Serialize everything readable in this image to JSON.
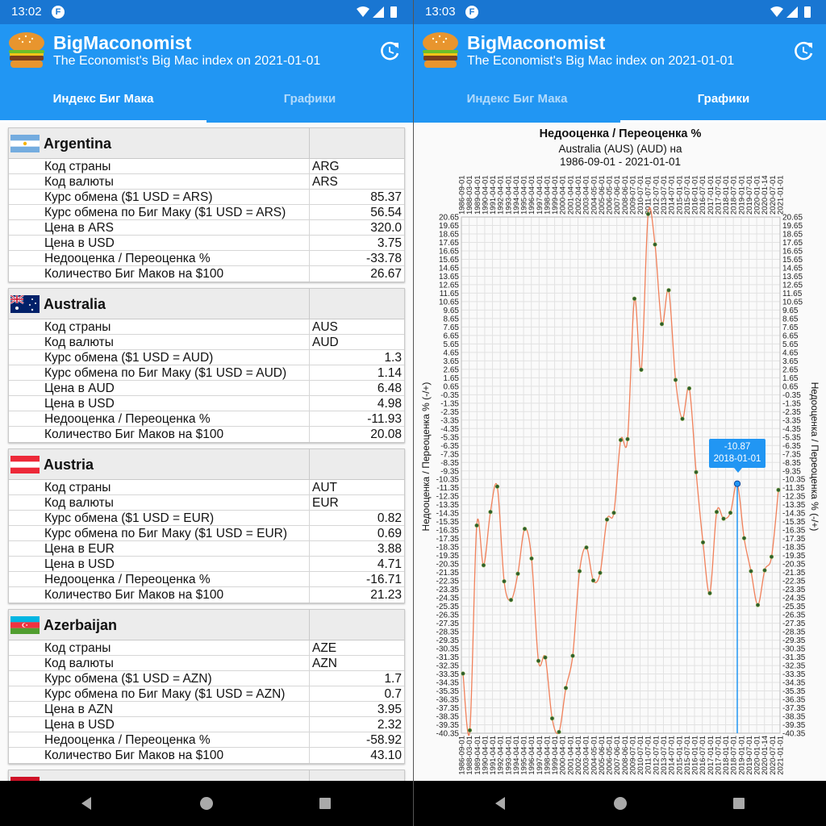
{
  "left_screen": {
    "status": {
      "time": "13:02",
      "badge": "F"
    },
    "app": {
      "title": "BigMaconomist",
      "subtitle": "The Economist's Big Mac index on 2021-01-01"
    },
    "tabs": [
      {
        "label": "Индекс Биг Мака",
        "active": true
      },
      {
        "label": "Графики",
        "active": false
      }
    ],
    "countries": [
      {
        "name": "Argentina",
        "flag": "argentina-flag",
        "rows": [
          {
            "label": "Код страны",
            "value": "ARG",
            "align": "left"
          },
          {
            "label": "Код валюты",
            "value": "ARS",
            "align": "left"
          },
          {
            "label": "Курс обмена ($1 USD = ARS)",
            "value": "85.37",
            "align": "right"
          },
          {
            "label": "Курс обмена по Биг Маку ($1 USD = ARS)",
            "value": "56.54",
            "align": "right"
          },
          {
            "label": "Цена в ARS",
            "value": "320.0",
            "align": "right"
          },
          {
            "label": "Цена в USD",
            "value": "3.75",
            "align": "right"
          },
          {
            "label": "Недооценка / Переоценка %",
            "value": "-33.78",
            "align": "right"
          },
          {
            "label": "Количество Биг Маков на $100",
            "value": "26.67",
            "align": "right"
          }
        ]
      },
      {
        "name": "Australia",
        "flag": "australia-flag",
        "rows": [
          {
            "label": "Код страны",
            "value": "AUS",
            "align": "left"
          },
          {
            "label": "Код валюты",
            "value": "AUD",
            "align": "left"
          },
          {
            "label": "Курс обмена ($1 USD = AUD)",
            "value": "1.3",
            "align": "right"
          },
          {
            "label": "Курс обмена по Биг Маку ($1 USD = AUD)",
            "value": "1.14",
            "align": "right"
          },
          {
            "label": "Цена в AUD",
            "value": "6.48",
            "align": "right"
          },
          {
            "label": "Цена в USD",
            "value": "4.98",
            "align": "right"
          },
          {
            "label": "Недооценка / Переоценка %",
            "value": "-11.93",
            "align": "right"
          },
          {
            "label": "Количество Биг Маков на $100",
            "value": "20.08",
            "align": "right"
          }
        ]
      },
      {
        "name": "Austria",
        "flag": "austria-flag",
        "rows": [
          {
            "label": "Код страны",
            "value": "AUT",
            "align": "left"
          },
          {
            "label": "Код валюты",
            "value": "EUR",
            "align": "left"
          },
          {
            "label": "Курс обмена ($1 USD = EUR)",
            "value": "0.82",
            "align": "right"
          },
          {
            "label": "Курс обмена по Биг Маку ($1 USD = EUR)",
            "value": "0.69",
            "align": "right"
          },
          {
            "label": "Цена в EUR",
            "value": "3.88",
            "align": "right"
          },
          {
            "label": "Цена в USD",
            "value": "4.71",
            "align": "right"
          },
          {
            "label": "Недооценка / Переоценка %",
            "value": "-16.71",
            "align": "right"
          },
          {
            "label": "Количество Биг Маков на $100",
            "value": "21.23",
            "align": "right"
          }
        ]
      },
      {
        "name": "Azerbaijan",
        "flag": "azerbaijan-flag",
        "rows": [
          {
            "label": "Код страны",
            "value": "AZE",
            "align": "left"
          },
          {
            "label": "Код валюты",
            "value": "AZN",
            "align": "left"
          },
          {
            "label": "Курс обмена ($1 USD = AZN)",
            "value": "1.7",
            "align": "right"
          },
          {
            "label": "Курс обмена по Биг Маку ($1 USD = AZN)",
            "value": "0.7",
            "align": "right"
          },
          {
            "label": "Цена в AZN",
            "value": "3.95",
            "align": "right"
          },
          {
            "label": "Цена в USD",
            "value": "2.32",
            "align": "right"
          },
          {
            "label": "Недооценка / Переоценка %",
            "value": "-58.92",
            "align": "right"
          },
          {
            "label": "Количество Биг Маков на $100",
            "value": "43.10",
            "align": "right"
          }
        ]
      }
    ]
  },
  "right_screen": {
    "status": {
      "time": "13:03",
      "badge": "F"
    },
    "app": {
      "title": "BigMaconomist",
      "subtitle": "The Economist's Big Mac index on 2021-01-01"
    },
    "tabs": [
      {
        "label": "Индекс Биг Мака",
        "active": false
      },
      {
        "label": "Графики",
        "active": true
      }
    ],
    "chart_header": {
      "title": "Недооценка / Переоценка %",
      "subtitle_line1": "Australia (AUS) (AUD) на",
      "subtitle_line2": "1986-09-01 - 2021-01-01",
      "y_axis_label": "Недооценка / Переоценка % (-/+)"
    },
    "tooltip": {
      "value": "-10.87",
      "date": "2018-01-01"
    }
  },
  "chart_data": {
    "type": "line",
    "title": "Недооценка / Переоценка %",
    "subtitle": "Australia (AUS) (AUD) на 1986-09-01 - 2021-01-01",
    "ylabel": "Недооценка / Переоценка % (-/+)",
    "ylim": [
      -40.35,
      20.65
    ],
    "y_ticks": [
      20.65,
      19.65,
      18.65,
      17.65,
      16.65,
      15.65,
      14.65,
      13.65,
      12.65,
      11.65,
      10.65,
      9.65,
      8.65,
      7.65,
      6.65,
      5.65,
      4.65,
      3.65,
      2.65,
      1.65,
      0.65,
      -0.35,
      -1.35,
      -2.35,
      -3.35,
      -4.35,
      -5.35,
      -6.35,
      -7.35,
      -8.35,
      -9.35,
      -10.35,
      -11.35,
      -12.35,
      -13.35,
      -14.35,
      -15.35,
      -16.35,
      -17.35,
      -18.35,
      -19.35,
      -20.35,
      -21.35,
      -22.35,
      -23.35,
      -24.35,
      -25.35,
      -26.35,
      -27.35,
      -28.35,
      -29.35,
      -30.35,
      -31.35,
      -32.35,
      -33.35,
      -34.35,
      -35.35,
      -36.35,
      -37.35,
      -38.35,
      -39.35,
      -40.35
    ],
    "x_ticks": [
      "1986-09-01",
      "1988-03-01",
      "1989-04-01",
      "1990-04-01",
      "1991-04-01",
      "1992-04-01",
      "1993-04-01",
      "1994-04-01",
      "1995-04-01",
      "1996-04-01",
      "1997-04-01",
      "1998-04-01",
      "1999-04-01",
      "2000-04-01",
      "2001-04-01",
      "2002-04-01",
      "2003-04-01",
      "2004-05-01",
      "2005-06-01",
      "2006-05-01",
      "2007-06-01",
      "2008-06-01",
      "2009-07-01",
      "2010-07-01",
      "2011-07-01",
      "2012-07-01",
      "2013-07-01",
      "2014-07-01",
      "2015-01-01",
      "2015-07-01",
      "2016-01-01",
      "2016-07-01",
      "2017-01-01",
      "2017-07-01",
      "2018-01-01",
      "2018-07-01",
      "2019-01-01",
      "2019-07-01",
      "2020-01-01",
      "2020-01-14",
      "2020-07-01",
      "2021-01-01"
    ],
    "series": [
      {
        "name": "Australia (AUS) (AUD)",
        "color": "#f0805a",
        "values": [
          -33.3,
          -40.0,
          -15.8,
          -20.5,
          -14.2,
          -11.2,
          -22.4,
          -24.6,
          -21.5,
          -16.2,
          -19.7,
          -31.8,
          -31.4,
          -38.6,
          -40.2,
          -35.0,
          -31.2,
          -21.2,
          -18.4,
          -22.3,
          -21.4,
          -15.1,
          -14.3,
          -5.7,
          -5.6,
          11.0,
          2.6,
          21.0,
          17.4,
          8.0,
          12.0,
          1.4,
          -3.2,
          0.4,
          -9.5,
          -17.8,
          -23.8,
          -14.2,
          -15.0,
          -14.3,
          -10.87,
          -17.3,
          -21.2,
          -25.2,
          -21.1,
          -19.5,
          -11.6
        ]
      }
    ],
    "highlight": {
      "value": -10.87,
      "date": "2018-01-01"
    },
    "grid": true,
    "legend": "none"
  }
}
